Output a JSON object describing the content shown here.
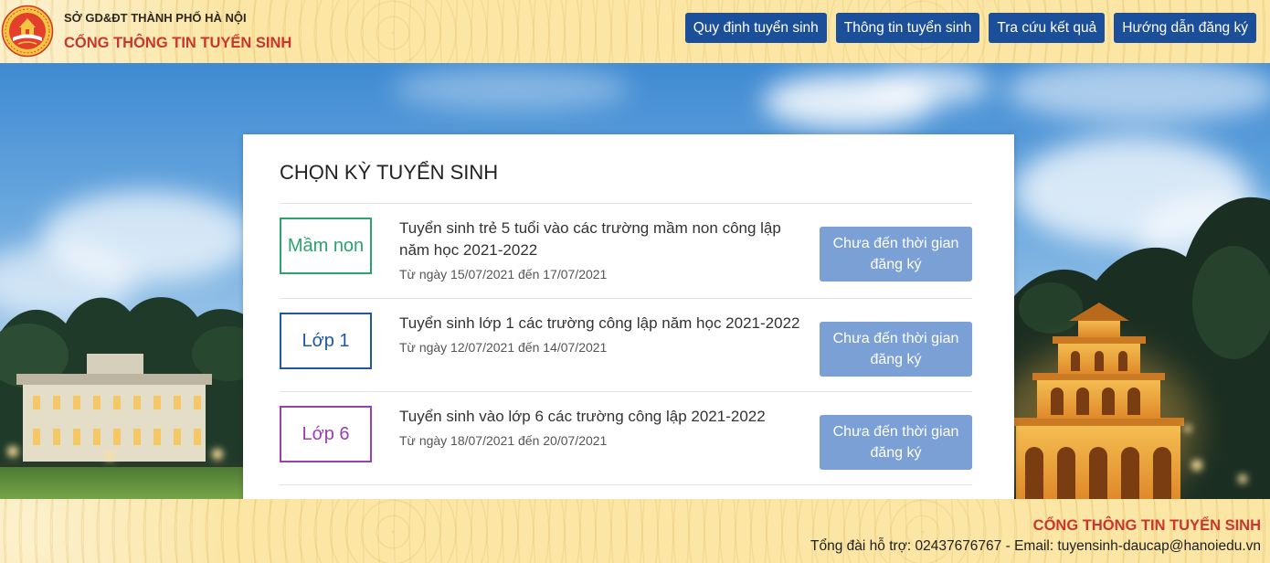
{
  "header": {
    "logo_icon": "hanoi-education-emblem-icon",
    "org_name": "SỞ GD&ĐT THÀNH PHỐ HÀ NỘI",
    "portal_name": "CỔNG THÔNG TIN TUYỂN SINH",
    "nav": [
      {
        "label": "Quy định tuyển sinh"
      },
      {
        "label": "Thông tin tuyển sinh"
      },
      {
        "label": "Tra cứu kết quả"
      },
      {
        "label": "Hướng dẫn đăng ký"
      }
    ]
  },
  "main": {
    "title": "CHỌN KỲ TUYỂN SINH",
    "periods": [
      {
        "level": "Mầm non",
        "color": "#2ba36c",
        "title": "Tuyển sinh trẻ 5 tuổi vào các trường mầm non công lập năm học 2021-2022",
        "dates": "Từ ngày 15/07/2021 đến 17/07/2021",
        "button": "Chưa đến thời gian đăng ký"
      },
      {
        "level": "Lớp 1",
        "color": "#1e58a3",
        "title": "Tuyển sinh lớp 1 các trường công lập năm học 2021-2022",
        "dates": "Từ ngày 12/07/2021 đến 14/07/2021",
        "button": "Chưa đến thời gian đăng ký"
      },
      {
        "level": "Lớp 6",
        "color": "#9c3eb3",
        "title": "Tuyển sinh vào lớp 6 các trường công lập 2021-2022",
        "dates": "Từ ngày 18/07/2021 đến 20/07/2021",
        "button": "Chưa đến thời gian đăng ký"
      }
    ]
  },
  "footer": {
    "portal_name": "CỔNG THÔNG TIN TUYỂN SINH",
    "contact": "Tổng đài hỗ trợ: 02437676767 - Email: tuyensinh-daucap@hanoiedu.vn"
  },
  "colors": {
    "nav_button": "#1c4f99",
    "brand_red": "#c9372c",
    "disabled_button": "#7ba0d6",
    "banner_background": "#fbe6a6"
  }
}
